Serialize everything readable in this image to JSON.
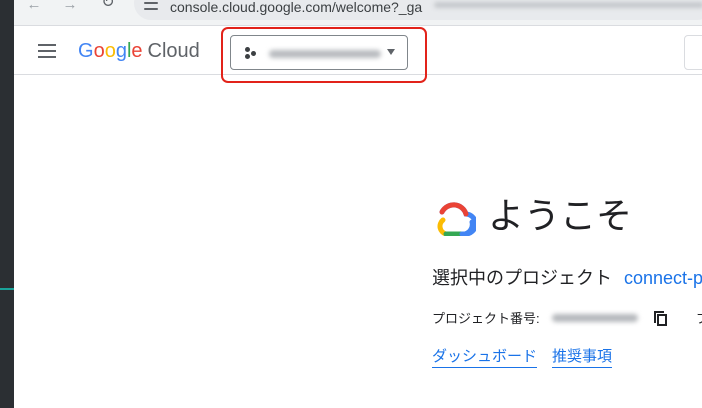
{
  "browser": {
    "back_glyph": "←",
    "forward_glyph": "→",
    "reload_glyph": "↻",
    "url": "console.cloud.google.com/welcome?_ga"
  },
  "header": {
    "logo": {
      "g1": "G",
      "g2": "o",
      "g3": "o",
      "g4": "g",
      "g5": "l",
      "g6": "e",
      "cloud": "Cloud"
    },
    "menu_icon": "hamburger-menu-icon",
    "project_picker_icon": "project-dots-icon"
  },
  "welcome": {
    "title": "ようこそ",
    "selected_project_label": "選択中のプロジェクト",
    "selected_project_link": "connect-p",
    "project_number_label": "プロジェクト番号:",
    "trailing_char": "プ",
    "links": {
      "dashboard": "ダッシュボード",
      "recommendations": "推奨事項"
    }
  },
  "colors": {
    "link": "#1a73e8",
    "highlight": "#e2231a",
    "google_blue": "#4285f4",
    "google_red": "#ea4335",
    "google_yellow": "#fbbc04",
    "google_green": "#34a853"
  }
}
